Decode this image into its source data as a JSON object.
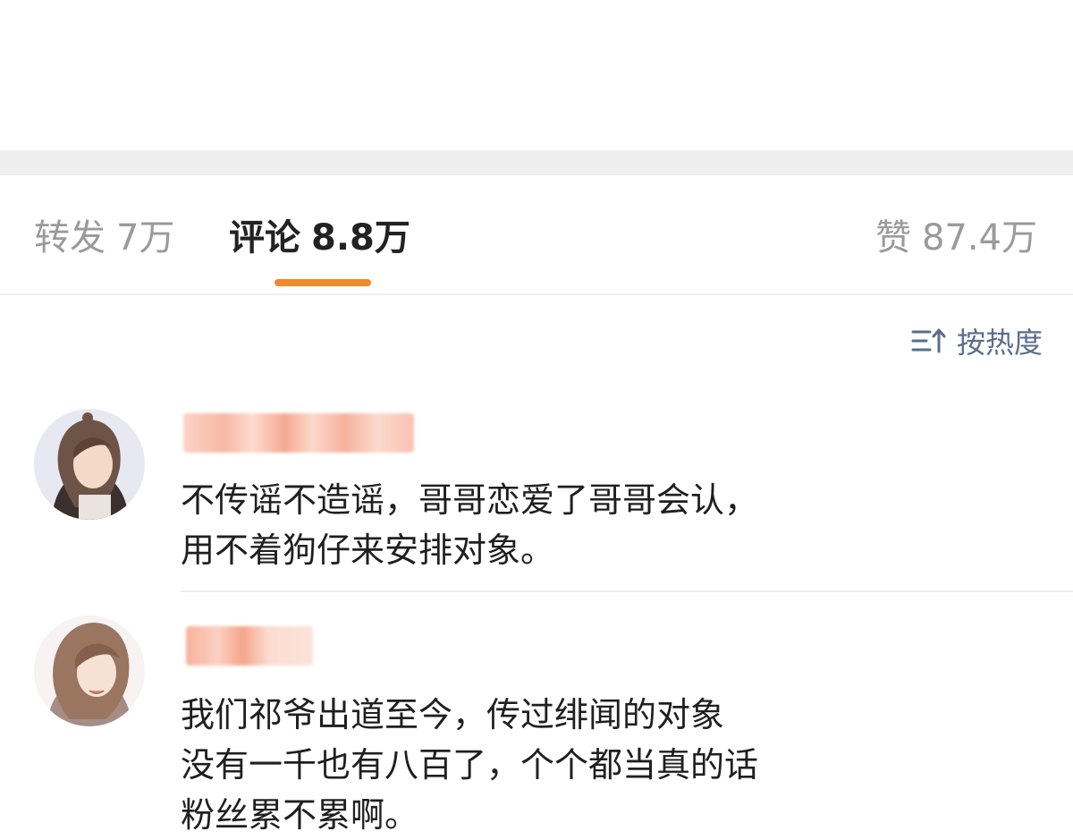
{
  "tabs": {
    "repost": {
      "label": "转发",
      "count": "7万"
    },
    "comments": {
      "label": "评论",
      "count": "8.8万"
    },
    "likes": {
      "label": "赞",
      "count": "87.4万"
    }
  },
  "sort": {
    "label": "按热度",
    "icon": "sort-icon"
  },
  "colors": {
    "accent": "#f08a2c",
    "tab_inactive": "#9a9a9a",
    "tab_active": "#222222",
    "sort_text": "#5a6d8c",
    "section_band": "#eeeeee",
    "username_blur": "#f7b7a3"
  },
  "comments": [
    {
      "avatar": "avatar",
      "lines": [
        "不传谣不造谣，哥哥恋爱了哥哥会认，",
        "用不着狗仔来安排对象。"
      ]
    },
    {
      "avatar": "avatar",
      "lines": [
        "我们祁爷出道至今，传过绯闻的对象",
        "没有一千也有八百了，个个都当真的话",
        "粉丝累不累啊。"
      ]
    }
  ]
}
